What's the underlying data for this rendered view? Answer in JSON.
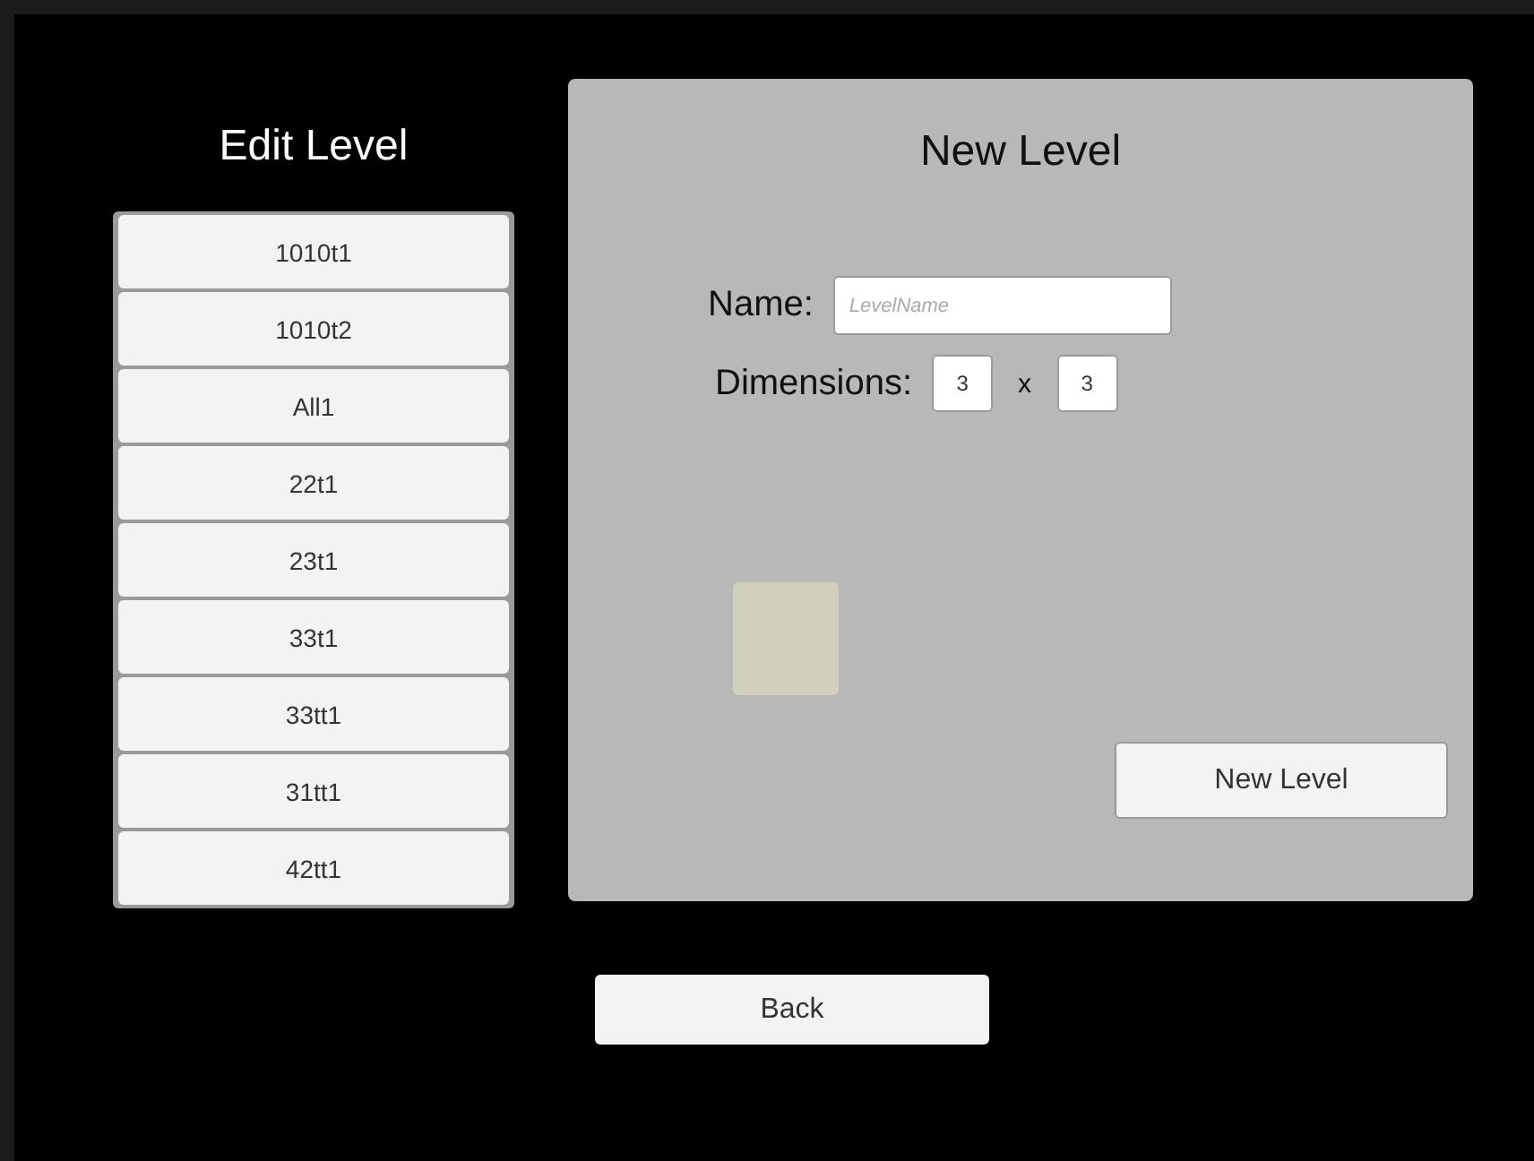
{
  "edit_panel": {
    "title": "Edit Level",
    "levels": [
      {
        "label": "1010t1"
      },
      {
        "label": "1010t2"
      },
      {
        "label": "All1"
      },
      {
        "label": "22t1"
      },
      {
        "label": "23t1"
      },
      {
        "label": "33t1"
      },
      {
        "label": "33tt1"
      },
      {
        "label": "31tt1"
      },
      {
        "label": "42tt1"
      }
    ]
  },
  "new_panel": {
    "title": "New Level",
    "name_label": "Name:",
    "name_field": {
      "placeholder": "LevelName"
    },
    "dimensions_label": "Dimensions:",
    "width_value": "3",
    "separator": "x",
    "height_value": "3",
    "create_button": "New Level"
  },
  "back_button": "Back"
}
